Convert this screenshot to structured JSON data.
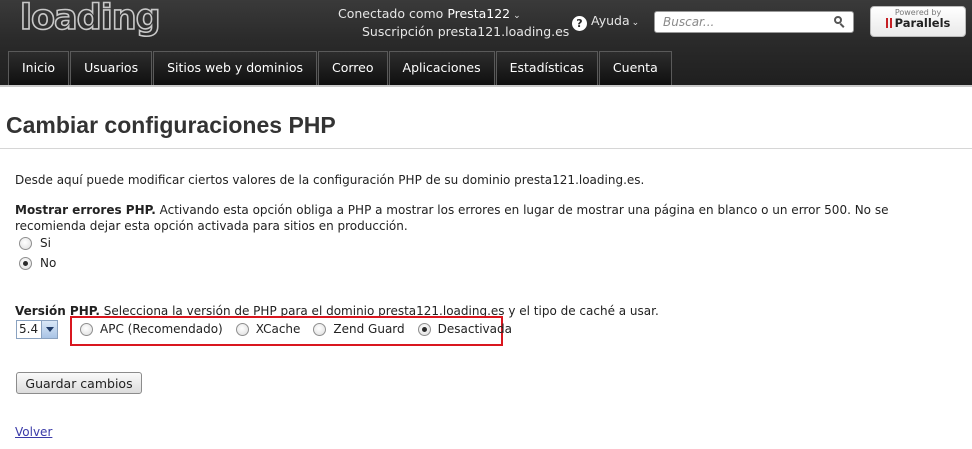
{
  "header": {
    "logo_text": "loading",
    "account": {
      "connected_label": "Conectado como",
      "username": "Presta122",
      "subscription_label": "Suscripción",
      "subscription_domain": "presta121.loading.es"
    },
    "help_label": "Ayuda",
    "search": {
      "placeholder": "Buscar..."
    },
    "powered_by": "Powered by",
    "brand": "Parallels"
  },
  "nav": {
    "tabs": [
      "Inicio",
      "Usuarios",
      "Sitios web y dominios",
      "Correo",
      "Aplicaciones",
      "Estadísticas",
      "Cuenta"
    ]
  },
  "main": {
    "title": "Cambiar configuraciones PHP",
    "intro": "Desde aquí puede modificar ciertos valores de la configuración PHP de su dominio presta121.loading.es.",
    "errors": {
      "label": "Mostrar errores PHP.",
      "description": "Activando esta opción obliga a PHP a mostrar los errores en lugar de mostrar una página en blanco o un error 500. No se recomienda dejar esta opción activada para sitios en producción.",
      "options": [
        {
          "label": "Si",
          "checked": false
        },
        {
          "label": "No",
          "checked": true
        }
      ]
    },
    "version": {
      "label": "Versión PHP.",
      "description": "Selecciona la versión de PHP para el dominio presta121.loading.es y el tipo de caché a usar.",
      "selected": "5.4",
      "cache_options": [
        {
          "label": "APC (Recomendado)",
          "checked": false
        },
        {
          "label": "XCache",
          "checked": false
        },
        {
          "label": "Zend Guard",
          "checked": false
        },
        {
          "label": "Desactivada",
          "checked": true
        }
      ]
    },
    "save_label": "Guardar cambios",
    "back_label": "Volver"
  },
  "colors": {
    "header_bg": "#2b2b2b",
    "highlight_border": "#d9161f",
    "link": "#3a3aa8",
    "logo_accent": "#e0a23a"
  }
}
